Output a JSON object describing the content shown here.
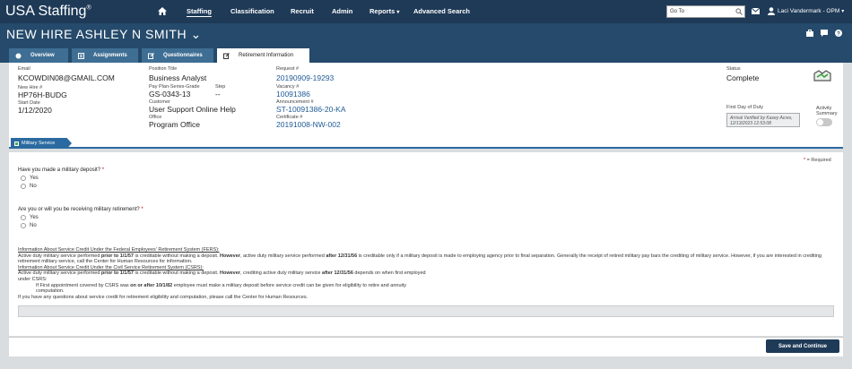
{
  "app": {
    "logo": "USA Staffing",
    "logo_mark": "®"
  },
  "nav": {
    "items": [
      {
        "label": "Staffing",
        "active": true
      },
      {
        "label": "Classification"
      },
      {
        "label": "Recruit"
      },
      {
        "label": "Admin"
      },
      {
        "label": "Reports",
        "dropdown": true
      },
      {
        "label": "Advanced Search"
      }
    ],
    "goto_placeholder": "Go To",
    "user_name": "Laci Vandermark - OPM"
  },
  "page": {
    "title": "NEW HIRE ASHLEY N SMITH",
    "title_caret": "⌄"
  },
  "tabs": [
    {
      "label": "Overview"
    },
    {
      "label": "Assignments"
    },
    {
      "label": "Questionnaires"
    },
    {
      "label": "Retirement Information",
      "active": true
    }
  ],
  "info": {
    "email_label": "Email",
    "email": "KCOWDIN08@GMAIL.COM",
    "newhire_label": "New Hire #",
    "newhire": "HP76H-BUDG",
    "start_label": "Start Date",
    "start": "1/12/2020",
    "position_label": "Position Title",
    "position": "Business Analyst",
    "pps_label": "Pay Plan-Series-Grade",
    "pps": "GS-0343-13",
    "step_label": "Step",
    "step": "--",
    "customer_label": "Customer",
    "customer": "User Support Online Help",
    "office_label": "Office",
    "office": "Program Office",
    "request_label": "Request #",
    "request": "20190909-19293",
    "vacancy_label": "Vacancy #",
    "vacancy": "10091386",
    "announcement_label": "Announcement #",
    "announcement": "ST-10091386-20-KA",
    "certificate_label": "Certificate #",
    "certificate": "20191008-NW-002",
    "status_label": "Status",
    "status": "Complete",
    "fdd_label": "First Day of Duty",
    "arrival_text": "Arrival Verified by Kasey Acres, 12/13/2023 12:53:08",
    "activity_label_1": "Activity",
    "activity_label_2": "Summary"
  },
  "section": {
    "label": "Military Service"
  },
  "form": {
    "required_note": "= Required",
    "required_star": "*",
    "q1": "Have you made a military deposit?",
    "q2": "Are you or will you be receiving military retirement?",
    "opt_yes": "Yes",
    "opt_no": "No",
    "fers_heading": "Information About Service Credit Under the Federal Employees' Retirement System (FERS):",
    "fers_a": "Active duty military service performed ",
    "fers_b": "prior to 1/1/57",
    "fers_c": " is creditable without making a deposit. ",
    "fers_d": "However",
    "fers_e": ", active duty military service performed ",
    "fers_f": "after 12/31/56",
    "fers_g": " is creditable only if a military deposit is made to employing agency prior to final separation. Generally the receipt of retired military pay bars the crediting of military service. However, if you are interested in crediting retirement military service, call the Center for Human Resources for information.",
    "csrs_heading": "Information About Service Credit Under the Civil Service Retirement System (CSRS):",
    "csrs_a": "Active duty military service performed ",
    "csrs_b": "prior to 1/1/57",
    "csrs_c": " is creditable without making a deposit. ",
    "csrs_d": "However",
    "csrs_e": ", crediting active duty military service ",
    "csrs_f": "after 12/31/56",
    "csrs_g": " depends on when first employed",
    "csrs_under": "under CSRS:",
    "csrs_ind_a": "If First appointment covered by CSRS was ",
    "csrs_ind_b": "on or after 10/1/82",
    "csrs_ind_c": " employee must make a military deposit before service credit can be given for eligibility to retire and annuity",
    "csrs_ind_d": "computation.",
    "closing": "If you have any questions about service credit for retirement eligibility and computation, please call the Center for Human Resources."
  },
  "footer": {
    "save_label": "Save and Continue"
  },
  "colors": {
    "nav_bg": "#1e3a57",
    "title_bg": "#254a6b",
    "accent": "#2b6aa0",
    "link": "#1f5a96",
    "required": "#cc0000"
  },
  "icons": [
    "home-icon",
    "search-icon",
    "mail-icon",
    "user-icon",
    "briefcase-icon",
    "chat-icon",
    "help-icon",
    "overview-icon",
    "assignments-icon",
    "questionnaires-icon",
    "edit-icon",
    "handshake-icon"
  ]
}
